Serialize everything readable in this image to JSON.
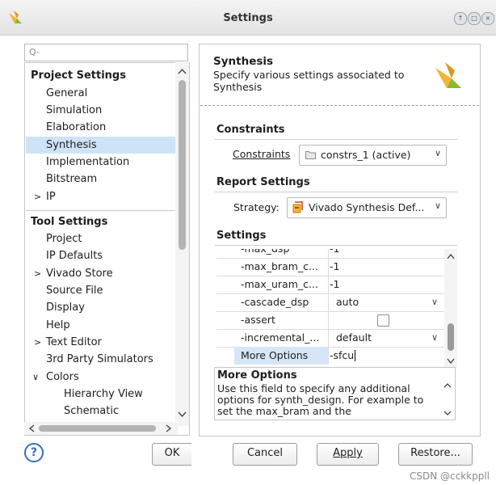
{
  "window": {
    "title": "Settings",
    "controls": [
      "↑",
      "□",
      "×"
    ]
  },
  "search": {
    "placeholder": "Q-"
  },
  "tree": {
    "project_settings": {
      "header": "Project Settings",
      "items": [
        "General",
        "Simulation",
        "Elaboration",
        "Synthesis",
        "Implementation",
        "Bitstream",
        "IP"
      ]
    },
    "tool_settings": {
      "header": "Tool Settings",
      "items": [
        "Project",
        "IP Defaults",
        "Vivado Store",
        "Source File",
        "Display",
        "Help",
        "Text Editor",
        "3rd Party Simulators",
        "Colors",
        "Hierarchy View",
        "Schematic"
      ]
    },
    "selected": "Synthesis"
  },
  "panel": {
    "title": "Synthesis",
    "subtitle": "Specify various settings associated to Synthesis",
    "constraints": {
      "section": "Constraints",
      "label": "Constraints",
      "value": "constrs_1 (active)"
    },
    "report": {
      "section": "Report Settings",
      "strategy_label": "Strategy:",
      "strategy_value": "Vivado Synthesis Def..."
    },
    "settings": {
      "section": "Settings",
      "rows": [
        {
          "name": "-max_dsp",
          "value": "-1"
        },
        {
          "name": "-max_bram_c...",
          "value": "-1"
        },
        {
          "name": "-max_uram_c...",
          "value": "-1"
        },
        {
          "name": "-cascade_dsp",
          "value": "auto"
        },
        {
          "name": "-assert",
          "value": ""
        },
        {
          "name": "-incremental_...",
          "value": "default"
        },
        {
          "name": "More Options",
          "value": "-sfcu"
        }
      ]
    },
    "description": {
      "title": "More Options",
      "text": "Use this field to specify any additional options for synth_design. For example to set the max_bram and the"
    }
  },
  "buttons": {
    "help": "?",
    "ok": "OK",
    "cancel": "Cancel",
    "apply": "Apply",
    "restore": "Restore..."
  },
  "watermark": "CSDN @cckkppll",
  "colors": {
    "selection": "#cfe3f7",
    "highlight_cell": "#d6e6f7",
    "logo_yellow": "#f2b632",
    "logo_green": "#8fb82e"
  },
  "icons": [
    "vivado-logo-icon",
    "search-icon",
    "constraints-folder-icon",
    "strategy-icon",
    "chevron-down-icon",
    "help-icon"
  ]
}
